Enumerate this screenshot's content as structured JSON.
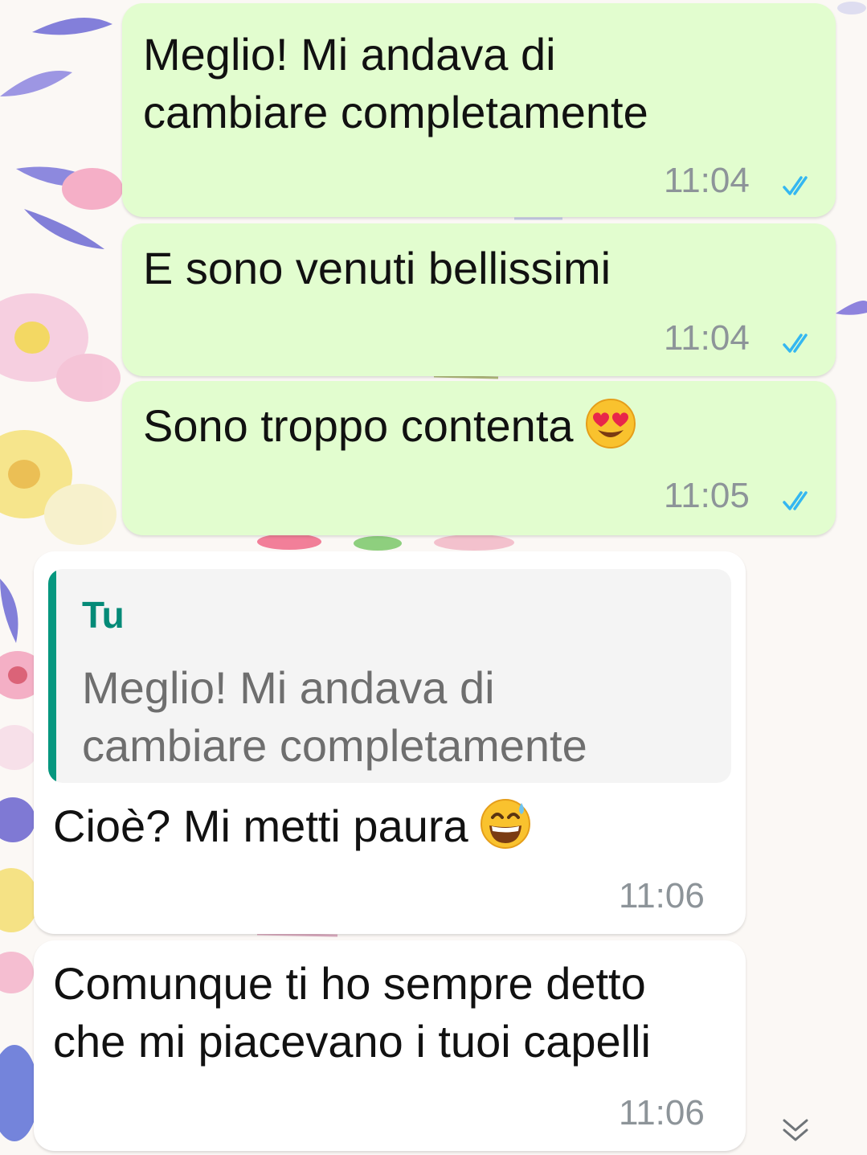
{
  "messages": [
    {
      "text_lines": [
        "Meglio! Mi andava di",
        "cambiare completamente"
      ],
      "time": "11:04",
      "direction": "outgoing",
      "status": "read"
    },
    {
      "text_lines": [
        "E sono venuti bellissimi"
      ],
      "time": "11:04",
      "direction": "outgoing",
      "status": "read"
    },
    {
      "text_lines": [
        "Sono troppo contenta"
      ],
      "emoji": "heart-eyes-emoji",
      "time": "11:05",
      "direction": "outgoing",
      "status": "read"
    },
    {
      "quote": {
        "author": "Tu",
        "text_lines": [
          "Meglio! Mi andava di",
          "cambiare completamente"
        ]
      },
      "text_lines": [
        "Cioè? Mi metti paura"
      ],
      "emoji": "grinning-sweat-emoji",
      "time": "11:06",
      "direction": "incoming"
    },
    {
      "text_lines": [
        "Comunque ti ho sempre detto",
        "che mi piacevano i tuoi capelli"
      ],
      "time": "11:06",
      "direction": "incoming"
    }
  ],
  "icons": {
    "read_receipt": "double-check-icon",
    "scroll_down": "chevron-double-down-icon"
  },
  "colors": {
    "outgoing_bubble": "#e2fdcf",
    "incoming_bubble": "#ffffff",
    "read_check": "#34b7f1",
    "quote_accent": "#06977f",
    "timestamp": "#8d9499"
  }
}
